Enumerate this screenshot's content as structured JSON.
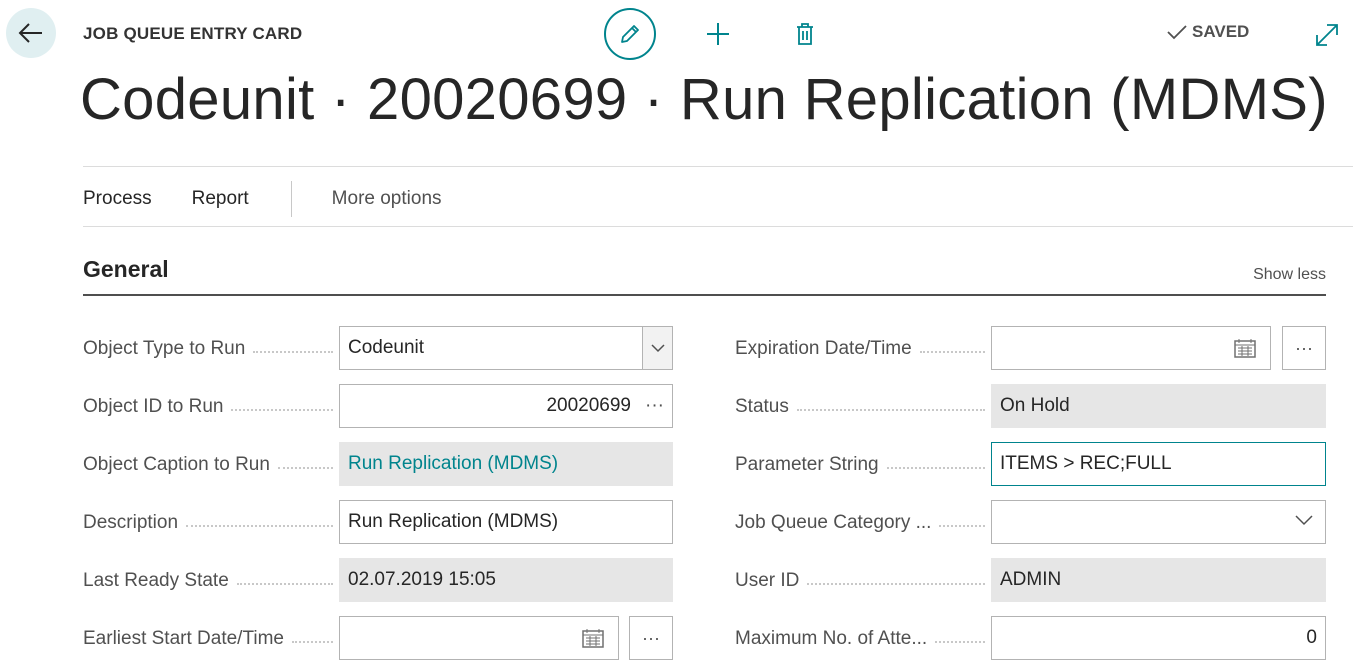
{
  "header": {
    "card_label": "JOB QUEUE ENTRY CARD",
    "saved_label": "SAVED",
    "title": "Codeunit · 20020699 · Run Replication (MDMS)"
  },
  "actions": {
    "process": "Process",
    "report": "Report",
    "more": "More options"
  },
  "section": {
    "title": "General",
    "toggle": "Show less"
  },
  "left_fields": {
    "object_type": {
      "label": "Object Type to Run",
      "value": "Codeunit"
    },
    "object_id": {
      "label": "Object ID to Run",
      "value": "20020699",
      "lookup": "···"
    },
    "object_caption": {
      "label": "Object Caption to Run",
      "value": "Run Replication (MDMS)"
    },
    "description": {
      "label": "Description",
      "value": "Run Replication (MDMS)"
    },
    "last_ready_state": {
      "label": "Last Ready State",
      "value": "02.07.2019 15:05"
    },
    "earliest_start": {
      "label": "Earliest Start Date/Time",
      "value": "",
      "lookup": "···"
    }
  },
  "right_fields": {
    "expiration": {
      "label": "Expiration Date/Time",
      "value": "",
      "lookup": "···"
    },
    "status": {
      "label": "Status",
      "value": "On Hold"
    },
    "parameter_string": {
      "label": "Parameter String",
      "value": "ITEMS > REC;FULL"
    },
    "category": {
      "label": "Job Queue Category ...",
      "value": ""
    },
    "user_id": {
      "label": "User ID",
      "value": "ADMIN"
    },
    "max_attempts": {
      "label": "Maximum No. of Atte...",
      "value": "0"
    }
  },
  "colors": {
    "accent": "#00848d",
    "back_bg": "#e0eff1",
    "readonly_bg": "#e6e6e6"
  },
  "icons": [
    "back-arrow-icon",
    "pencil-icon",
    "plus-icon",
    "trash-icon",
    "checkmark-icon",
    "expand-icon",
    "chevron-down-icon",
    "calendar-icon"
  ]
}
